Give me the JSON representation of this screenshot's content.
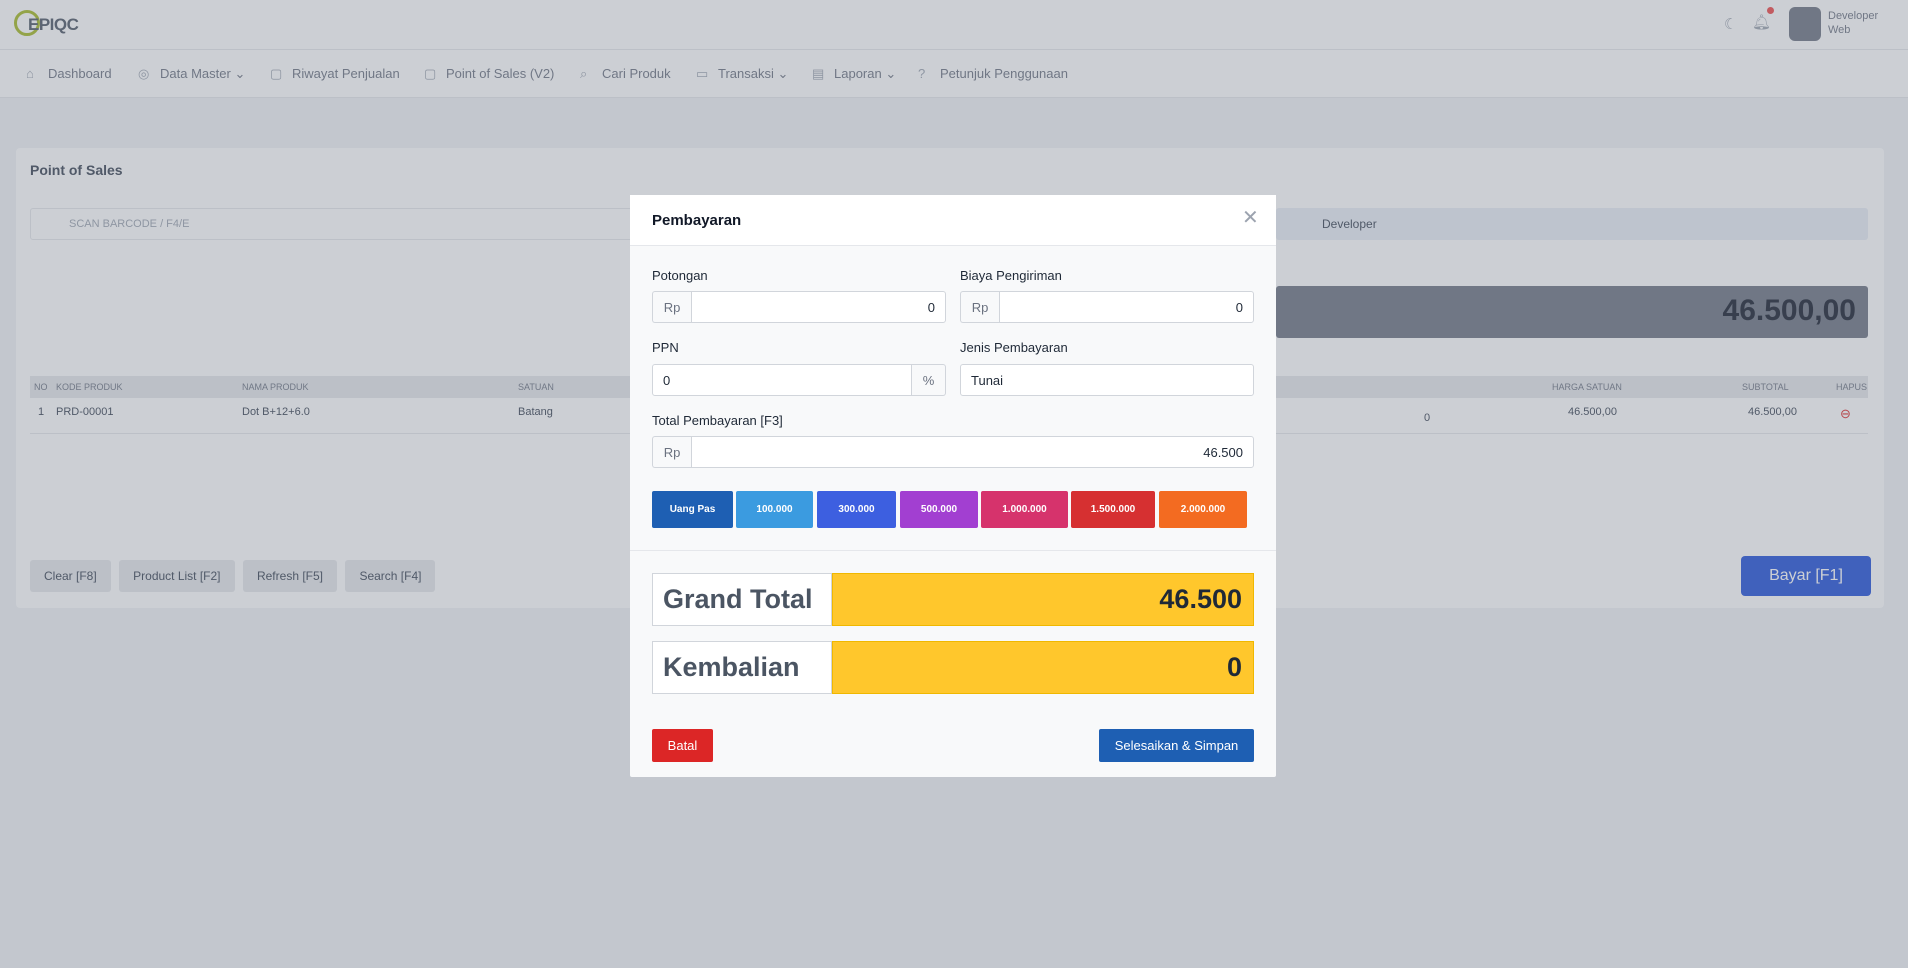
{
  "app": {
    "logo_text": "EPIQC",
    "user": {
      "name": "Developer",
      "role": "Web"
    }
  },
  "nav": {
    "items": [
      {
        "label": "Dashboard",
        "icon": "home-icon"
      },
      {
        "label": "Data Master",
        "icon": "database-icon",
        "dropdown": true
      },
      {
        "label": "Riwayat Penjualan",
        "icon": "history-icon"
      },
      {
        "label": "Point of Sales (V2)",
        "icon": "pos-icon"
      },
      {
        "label": "Cari Produk",
        "icon": "search-icon"
      },
      {
        "label": "Transaksi",
        "icon": "transaction-icon",
        "dropdown": true
      },
      {
        "label": "Laporan",
        "icon": "report-icon",
        "dropdown": true
      },
      {
        "label": "Petunjuk Penggunaan",
        "icon": "help-icon"
      }
    ]
  },
  "pos": {
    "title": "Point of Sales",
    "search_placeholder": "SCAN BARCODE / F4/E",
    "customer": "Developer",
    "total": "46.500,00",
    "table": {
      "headers": [
        "NO",
        "KODE PRODUK",
        "NAMA PRODUK",
        "SATUAN",
        "HARGA SATUAN",
        "SUBTOTAL",
        "HAPUS"
      ],
      "rows": [
        {
          "no": "1",
          "code": "PRD-00001",
          "name": "Dot B+12+6.0",
          "unit": "Batang",
          "qty": "0",
          "price": "46.500,00",
          "subtotal": "46.500,00"
        }
      ]
    },
    "actions": [
      "Clear [F8]",
      "Product List [F2]",
      "Refresh [F5]",
      "Search [F4]"
    ],
    "pay_button": "Bayar [F1]"
  },
  "modal": {
    "title": "Pembayaran",
    "potongan": {
      "label": "Potongan",
      "prefix": "Rp",
      "value": "0"
    },
    "biaya_pengiriman": {
      "label": "Biaya Pengiriman",
      "prefix": "Rp",
      "value": "0"
    },
    "ppn": {
      "label": "PPN",
      "value": "0",
      "suffix": "%"
    },
    "jenis_pembayaran": {
      "label": "Jenis Pembayaran",
      "value": "Tunai"
    },
    "total_pembayaran": {
      "label": "Total Pembayaran [F3]",
      "prefix": "Rp",
      "value": "46.500"
    },
    "quick_amounts": [
      {
        "label": "Uang Pas",
        "color": "#1e5fb3"
      },
      {
        "label": "100.000",
        "color": "#3b9be0"
      },
      {
        "label": "300.000",
        "color": "#3d5fe0"
      },
      {
        "label": "500.000",
        "color": "#a23fd1"
      },
      {
        "label": "1.000.000",
        "color": "#d6336c"
      },
      {
        "label": "1.500.000",
        "color": "#d63031"
      },
      {
        "label": "2.000.000",
        "color": "#f36b21"
      }
    ],
    "grand_total": {
      "label": "Grand Total",
      "value": "46.500"
    },
    "kembalian": {
      "label": "Kembalian",
      "value": "0"
    },
    "cancel_label": "Batal",
    "submit_label": "Selesaikan & Simpan",
    "highlight_color": "#ffc72c"
  }
}
